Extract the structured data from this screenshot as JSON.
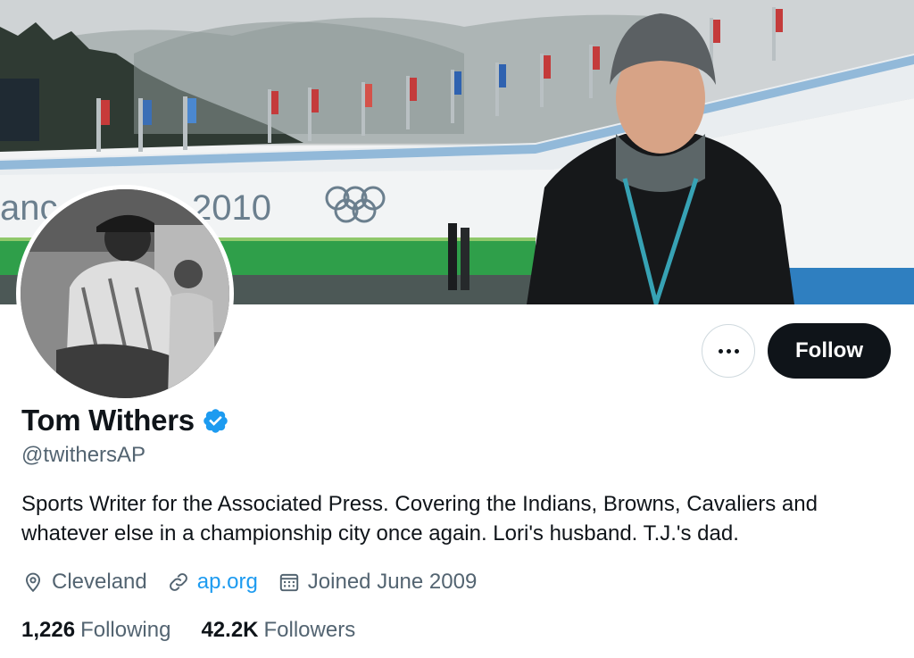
{
  "profile": {
    "name": "Tom Withers",
    "handle": "@twithersAP",
    "bio": "Sports Writer for the Associated Press. Covering the Indians, Browns, Cavaliers and whatever else in a championship city once again. Lori's husband. T.J.'s dad.",
    "location": "Cleveland",
    "website": "ap.org",
    "joined": "Joined June 2009",
    "verified": true
  },
  "stats": {
    "following_count": "1,226",
    "following_label": "Following",
    "followers_count": "42.2K",
    "followers_label": "Followers"
  },
  "actions": {
    "follow_label": "Follow"
  },
  "banner": {
    "sign_text_left": "anc",
    "sign_text_year": "2010"
  },
  "colors": {
    "accent": "#1d9bf0",
    "primary_text": "#0f1419",
    "secondary_text": "#536471",
    "follow_bg": "#0f1419"
  },
  "icons": {
    "location": "map-pin-icon",
    "website": "link-icon",
    "joined": "calendar-icon",
    "verified": "verified-badge-icon",
    "more": "more-horizontal-icon"
  }
}
